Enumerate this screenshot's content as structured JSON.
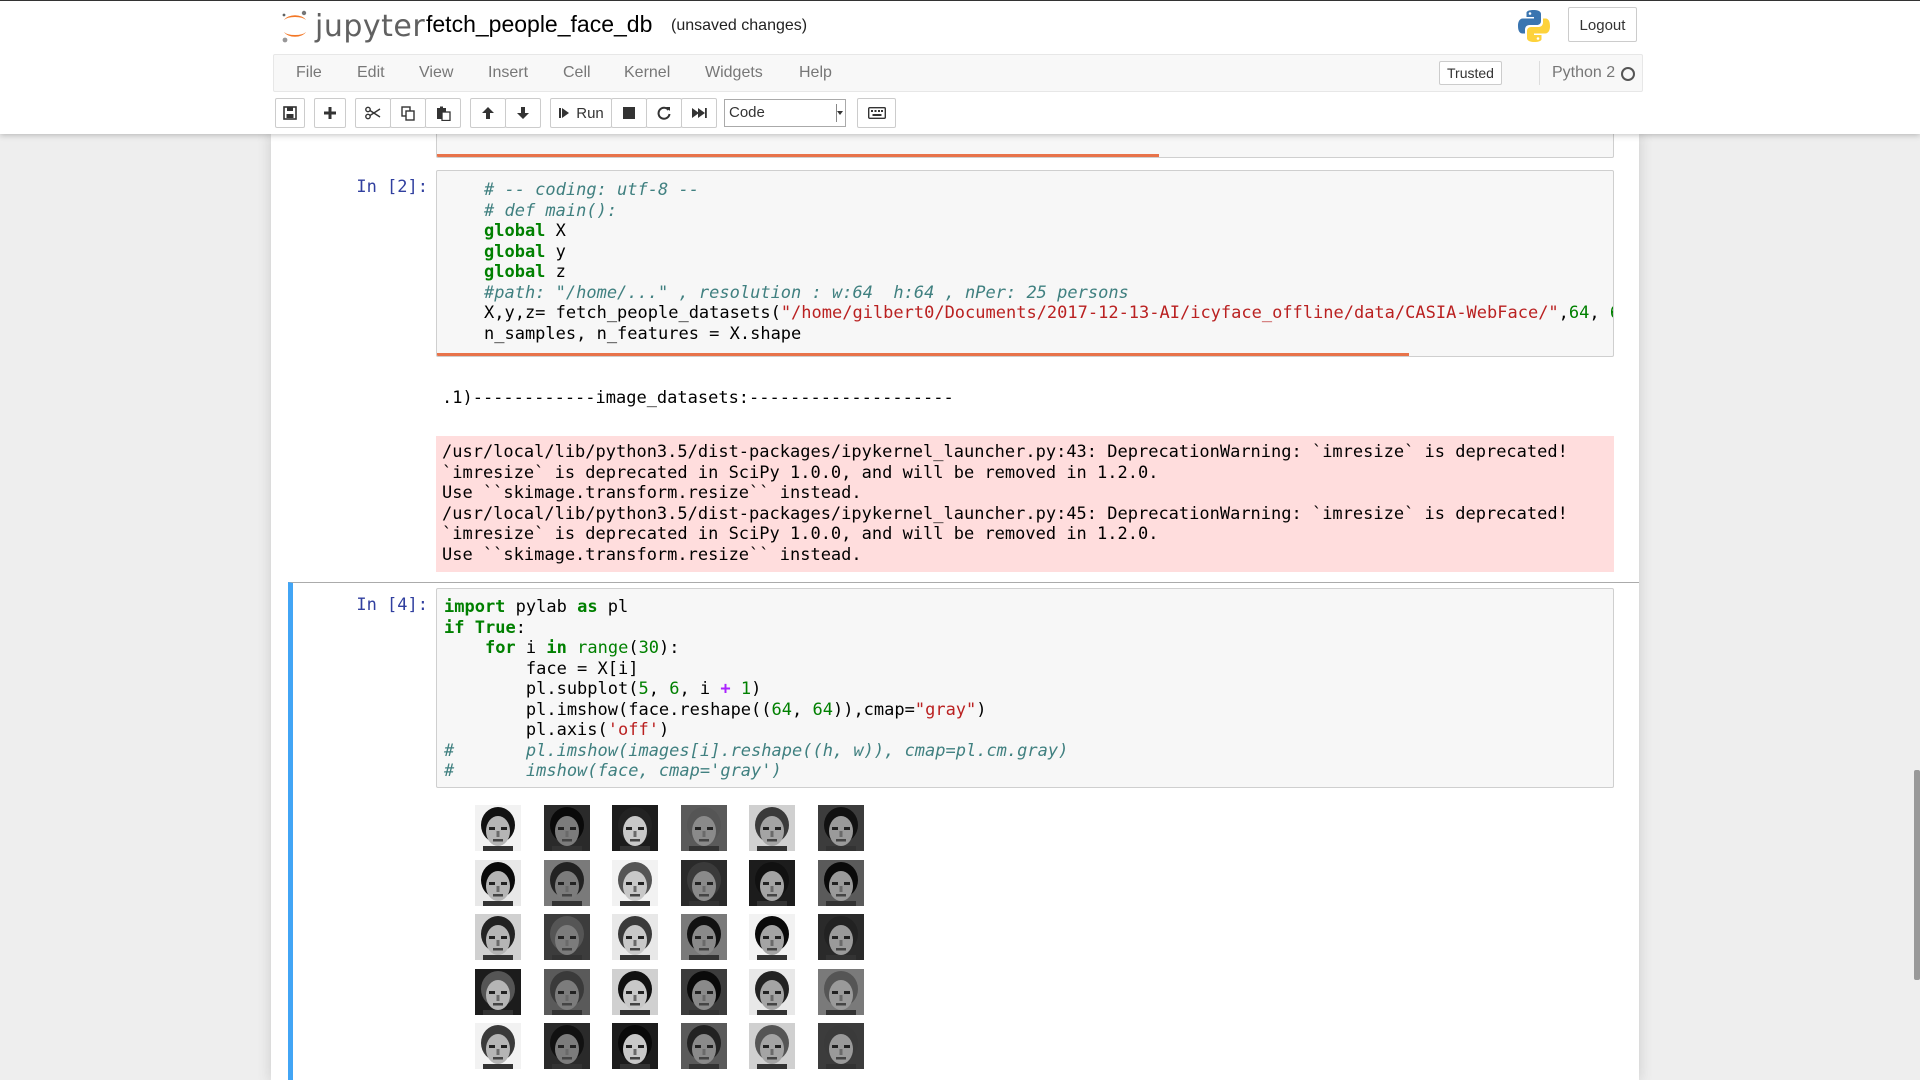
{
  "header": {
    "logo_text": "jupyter",
    "notebook_name": "fetch_people_face_db",
    "save_status": "(unsaved changes)",
    "logout_label": "Logout",
    "trusted_label": "Trusted",
    "kernel_name": "Python 2"
  },
  "menu": [
    "File",
    "Edit",
    "View",
    "Insert",
    "Cell",
    "Kernel",
    "Widgets",
    "Help"
  ],
  "toolbar": {
    "run_label": "Run",
    "cell_type": "Code"
  },
  "cells": {
    "cell2": {
      "prompt": "In [2]:",
      "output_line": ".1)------------image_datasets:--------------------",
      "stderr": [
        "/usr/local/lib/python3.5/dist-packages/ipykernel_launcher.py:43: DeprecationWarning: `imresize` is deprecated!",
        "`imresize` is deprecated in SciPy 1.0.0, and will be removed in 1.2.0.",
        "Use ``skimage.transform.resize`` instead.",
        "/usr/local/lib/python3.5/dist-packages/ipykernel_launcher.py:45: DeprecationWarning: `imresize` is deprecated!",
        "`imresize` is deprecated in SciPy 1.0.0, and will be removed in 1.2.0.",
        "Use ``skimage.transform.resize`` instead."
      ]
    },
    "cell4": {
      "prompt": "In [4]:"
    }
  },
  "faces": {
    "rows": 5,
    "cols": 6,
    "count": 30
  }
}
